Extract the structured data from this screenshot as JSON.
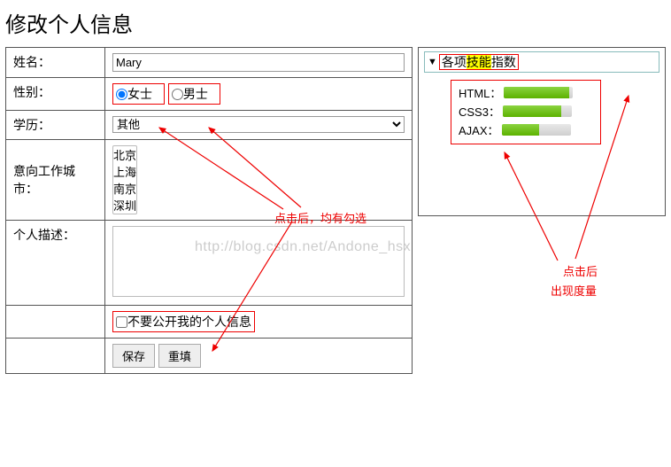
{
  "page": {
    "title": "修改个人信息"
  },
  "form": {
    "name_label": "姓名：",
    "name_value": "Mary",
    "gender_label": "性别：",
    "gender_female": "女士",
    "gender_male": "男士",
    "education_label": "学历：",
    "education_selected": "其他",
    "city_label": "意向工作城市：",
    "city_options": [
      "北京",
      "上海",
      "南京",
      "深圳"
    ],
    "desc_label": "个人描述：",
    "desc_value": "",
    "private_label": "不要公开我的个人信息",
    "save_button": "保存",
    "reset_button": "重填"
  },
  "sidebar": {
    "summary_prefix": "各项",
    "summary_highlight": "技能",
    "summary_suffix": "指数",
    "skills": [
      {
        "name": "HTML：",
        "percent": 95
      },
      {
        "name": "CSS3：",
        "percent": 85
      },
      {
        "name": "AJAX：",
        "percent": 55
      }
    ]
  },
  "annotations": {
    "radio_note": "点击后，均有勾选",
    "summary_note1": "点击后",
    "summary_note2": "出现度量"
  },
  "watermark": "http://blog.csdn.net/Andone_hsx"
}
